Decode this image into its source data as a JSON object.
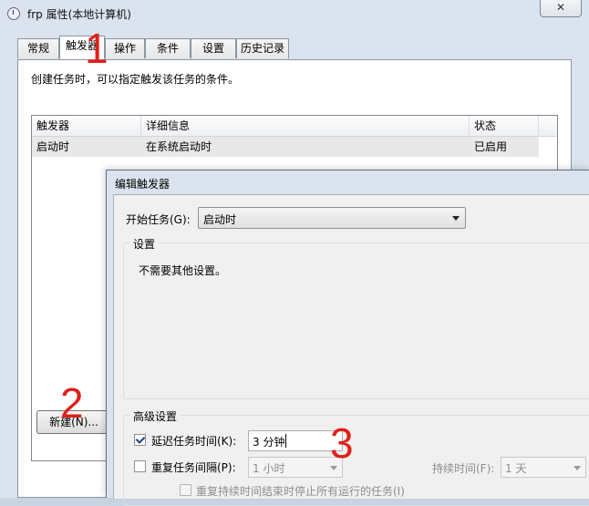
{
  "window": {
    "title": "frp 属性(本地计算机)",
    "close_symbol": "✕"
  },
  "tabs": [
    {
      "label": "常规"
    },
    {
      "label": "触发器"
    },
    {
      "label": "操作"
    },
    {
      "label": "条件"
    },
    {
      "label": "设置"
    },
    {
      "label": "历史记录"
    }
  ],
  "active_tab": "触发器",
  "trigger_page": {
    "description": "创建任务时，可以指定触发该任务的条件。",
    "columns": [
      "触发器",
      "详细信息",
      "状态"
    ],
    "rows": [
      {
        "trigger": "启动时",
        "details": "在系统启动时",
        "status": "已启用"
      }
    ],
    "new_button": "新建(N)..."
  },
  "annotations": [
    "1",
    "2",
    "3"
  ],
  "edit_dialog": {
    "title": "编辑触发器",
    "begin_task_label": "开始任务(G):",
    "begin_task_value": "启动时",
    "settings_group": "设置",
    "settings_text": "不需要其他设置。",
    "advanced_group": "高级设置",
    "delay_label": "延迟任务时间(K):",
    "delay_checked": true,
    "delay_value": "3 分钟",
    "repeat_label": "重复任务间隔(P):",
    "repeat_checked": false,
    "repeat_value": "1 小时",
    "duration_label": "持续时间(F):",
    "duration_value": "1 天",
    "stop_label": "重复持续时间结束时停止所有运行的任务(I)"
  },
  "colors": {
    "annotation": "#e0201b",
    "window_frame": "#dbe3ee"
  }
}
